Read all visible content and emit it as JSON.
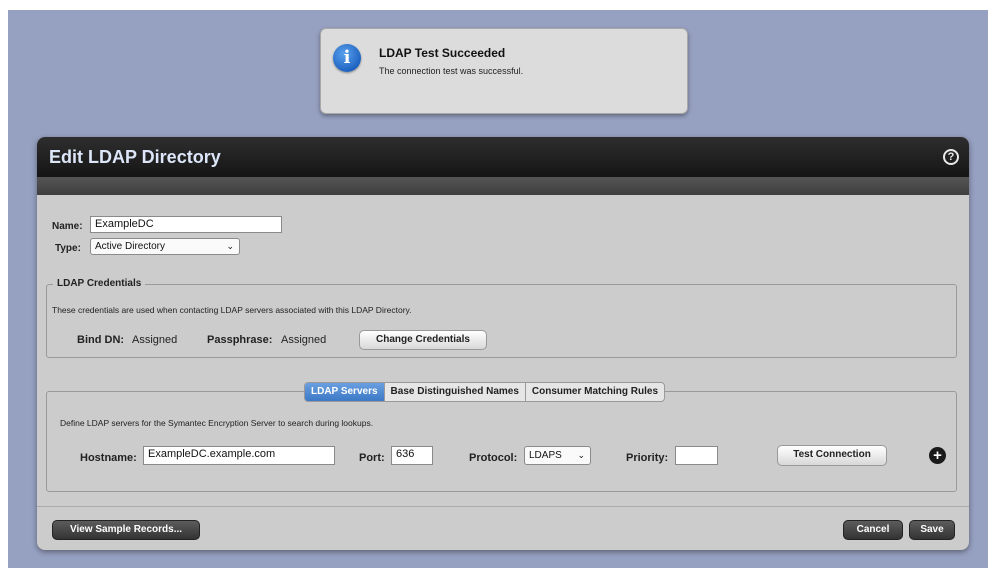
{
  "notification": {
    "title": "LDAP Test Succeeded",
    "message": "The connection test was successful.",
    "icon": "info-icon"
  },
  "dialog": {
    "title": "Edit LDAP Directory",
    "help_icon": "help-icon",
    "name_label": "Name:",
    "name_value": "ExampleDC",
    "type_label": "Type:",
    "type_value": "Active Directory",
    "credentials": {
      "legend": "LDAP Credentials",
      "description": "These credentials are used when contacting LDAP servers associated with this LDAP Directory.",
      "bind_dn_label": "Bind DN:",
      "bind_dn_value": "Assigned",
      "passphrase_label": "Passphrase:",
      "passphrase_value": "Assigned",
      "change_button": "Change Credentials"
    },
    "tabs": [
      {
        "label": "LDAP Servers",
        "active": true
      },
      {
        "label": "Base Distinguished Names",
        "active": false
      },
      {
        "label": "Consumer Matching Rules",
        "active": false
      }
    ],
    "servers": {
      "description": "Define LDAP servers for the Symantec Encryption Server to search during lookups.",
      "hostname_label": "Hostname:",
      "hostname_value": "ExampleDC.example.com",
      "port_label": "Port:",
      "port_value": "636",
      "protocol_label": "Protocol:",
      "protocol_value": "LDAPS",
      "priority_label": "Priority:",
      "priority_value": "",
      "test_button": "Test Connection",
      "add_icon": "plus-icon"
    },
    "footer": {
      "sample_button": "View Sample Records...",
      "cancel_button": "Cancel",
      "save_button": "Save"
    }
  },
  "colors": {
    "backdrop": "#96a0c0",
    "header": "#1e1e1e",
    "title_text": "#dce6f8",
    "active_tab": "#4a86d0",
    "dialog_body": "#cccccc"
  }
}
